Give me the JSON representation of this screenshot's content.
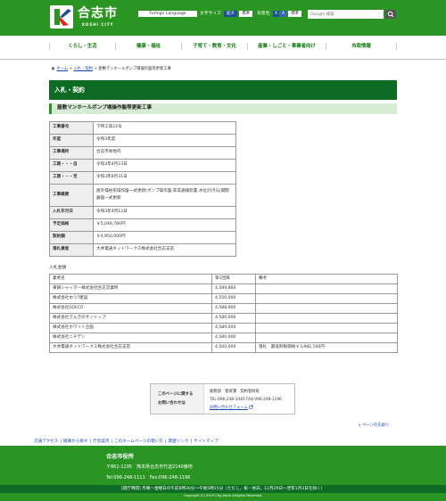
{
  "header": {
    "logo_text": "合志市",
    "logo_sub": "KOSHI CITY",
    "foreign_language": "Foreign Language",
    "font_size_label": "文字サイズ",
    "font_large": "拡大",
    "font_standard": "標準",
    "bg_color_label": "背景色",
    "bg_a1": "A",
    "bg_a2": "A",
    "bg_standard": "標準",
    "search_placeholder": "Google 検索",
    "colors": {
      "brand_green": "#2a9522",
      "dark_green": "#0d6b23",
      "link_blue": "#1a47b8"
    }
  },
  "gnav": [
    "くらし・生活",
    "健康・福祉",
    "子育て・教育・文化",
    "産業・しごと・事業者向け",
    "市政情報"
  ],
  "breadcrumb": {
    "home": "ホーム",
    "sep1": ">",
    "parent": "入札・契約",
    "sep2": ">",
    "current": "屋敷マンホールポンプ場操作盤等更新工事"
  },
  "page_title": "入札・契約",
  "section_title": "屋敷マンホールポンプ場操作盤等更新工事",
  "details": [
    {
      "label": "工事番号",
      "value": "下特工第22号"
    },
    {
      "label": "年度",
      "value": "令和3年度"
    },
    {
      "label": "工事場所",
      "value": "合志市栄地内"
    },
    {
      "label": "工期・・・自",
      "value": "令和3年4月23日"
    },
    {
      "label": "工期・・・至",
      "value": "令和3年8月31日"
    },
    {
      "label": "工事概要",
      "value": "屋外操柱形操作盤一式更新(ポンプ操作盤,非常通報装置,水位計)引込開閉器盤一式更新"
    },
    {
      "label": "入札年月日",
      "value": "令和3年4月12日"
    },
    {
      "label": "予定価格",
      "value": "￥5,048,780円"
    },
    {
      "label": "契約額",
      "value": "￥4,950,000円"
    },
    {
      "label": "落札業者",
      "value": "大共電通ネットワークス株式会社合志支店"
    }
  ],
  "bid_caption": "入札金額",
  "bid_table": {
    "headers": [
      "業者名",
      "第1回目",
      "備考"
    ],
    "rows": [
      [
        "東鋼シャッター株式会社合志営業所",
        "4,589,800",
        ""
      ],
      [
        "株式会社ゆう?建設",
        "4,550,000",
        ""
      ],
      [
        "株式会社EDECO",
        "4,588,900",
        ""
      ],
      [
        "株式会社でんきのサントップ",
        "4,580,000",
        ""
      ],
      [
        "株式会社ホワイト企画",
        "4,589,000",
        ""
      ],
      [
        "株式会社ニチデン",
        "4,580,000",
        ""
      ],
      [
        "大共電通ネットワークス株式会社合志支店",
        "4,500,000",
        "落札　最低制限価格￥3,982,160円"
      ]
    ]
  },
  "contact": {
    "title_line1": "このページに関する",
    "title_line2": "お問い合わせは",
    "dept": "総務部　管財課　契約管財班",
    "tel": "TEL:096-248-1040 FAX:096-248-1196",
    "form_link": "お問い合わせフォーム"
  },
  "page_top": "∧ ページの先頭へ",
  "footer_links": [
    "交通アクセス",
    "組織から探す",
    "庁舎案内",
    "このホームページの使い方",
    "関連リンク",
    "サイトマップ"
  ],
  "footer": {
    "name": "合志市役所",
    "address": "〒861-1195　熊本県合志市竹迫2140番地",
    "tel": "Tel:096-248-1111　Fax:096-248-1196",
    "hours": "[開庁時間] 月曜～金曜日の午前8時30分～午後5時15分（ただし，祝・休日，12月29日～翌年1月3日を除く）",
    "copyright": "Copyright (C) 2019 City-Koshi Allrights Reserved."
  }
}
